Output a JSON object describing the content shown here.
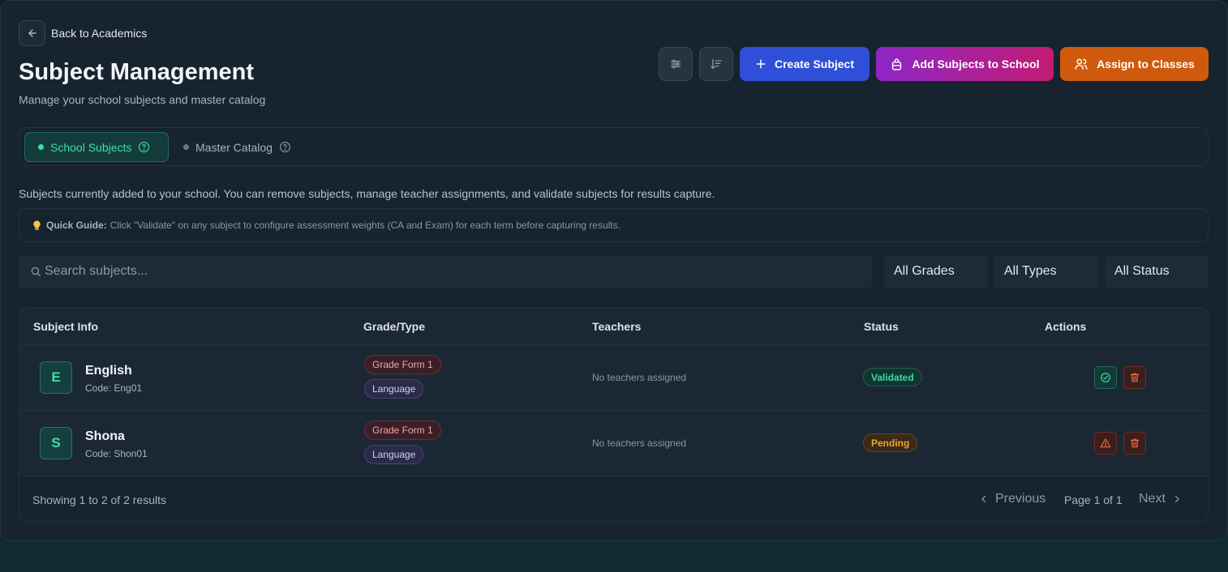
{
  "header": {
    "back_label": "Back to Academics",
    "title": "Subject Management",
    "subtitle": "Manage your school subjects and master catalog"
  },
  "toolbar": {
    "create_label": "Create Subject",
    "add_label": "Add Subjects to School",
    "assign_label": "Assign to Classes"
  },
  "tabs": [
    {
      "label": "School Subjects",
      "active": true
    },
    {
      "label": "Master Catalog",
      "active": false
    }
  ],
  "description": "Subjects currently added to your school. You can remove subjects, manage teacher assignments, and validate subjects for results capture.",
  "guide": {
    "title": "Quick Guide:",
    "text": "Click \"Validate\" on any subject to configure assessment weights (CA and Exam) for each term before capturing results."
  },
  "search": {
    "placeholder": "Search subjects..."
  },
  "filters": {
    "grades": "All Grades",
    "types": "All Types",
    "status": "All Status"
  },
  "table": {
    "headers": [
      "Subject Info",
      "Grade/Type",
      "Teachers",
      "Status",
      "Actions"
    ],
    "rows": [
      {
        "initial": "E",
        "name": "English",
        "code": "Code: Eng01",
        "grade": "Grade Form 1",
        "type": "Language",
        "teachers": "No teachers assigned",
        "status": "Validated"
      },
      {
        "initial": "S",
        "name": "Shona",
        "code": "Code: Shon01",
        "grade": "Grade Form 1",
        "type": "Language",
        "teachers": "No teachers assigned",
        "status": "Pending"
      }
    ]
  },
  "pagination": {
    "showing": "Showing 1 to 2 of 2 results",
    "previous": "Previous",
    "page_info": "Page 1 of 1",
    "next": "Next"
  },
  "colors": {
    "accent_teal": "#3ddbb6",
    "create_blue": "#2f4fd8",
    "add_purple": "#8e26c8",
    "assign_orange": "#cf5a0e",
    "status_pending": "#f5a524"
  }
}
